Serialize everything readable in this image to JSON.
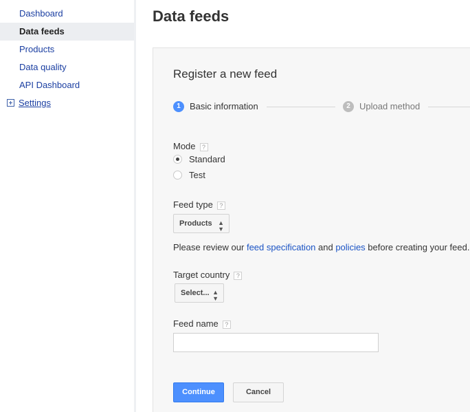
{
  "sidebar": {
    "items": [
      {
        "label": "Dashboard"
      },
      {
        "label": "Data feeds"
      },
      {
        "label": "Products"
      },
      {
        "label": "Data quality"
      },
      {
        "label": "API Dashboard"
      },
      {
        "label": "Settings"
      }
    ],
    "active_item": "Data feeds"
  },
  "page": {
    "title": "Data feeds"
  },
  "form": {
    "title": "Register a new feed",
    "steps": [
      {
        "number": "1",
        "label": "Basic information",
        "state": "active"
      },
      {
        "number": "2",
        "label": "Upload method",
        "state": "inactive"
      }
    ],
    "help_glyph": "?",
    "mode": {
      "label": "Mode",
      "options": [
        {
          "label": "Standard",
          "checked": true
        },
        {
          "label": "Test",
          "checked": false
        }
      ]
    },
    "feed_type": {
      "label": "Feed type",
      "value": "Products"
    },
    "review": {
      "prefix": "Please review our ",
      "link1": "feed specification",
      "middle": " and ",
      "link2": "policies",
      "suffix": " before creating your feed."
    },
    "target_country": {
      "label": "Target country",
      "value": "Select..."
    },
    "feed_name": {
      "label": "Feed name",
      "value": "",
      "placeholder": ""
    },
    "buttons": {
      "continue": "Continue",
      "cancel": "Cancel"
    }
  },
  "colors": {
    "link": "#1a3ea1",
    "primary_button": "#4d90fe",
    "panel_bg": "#f7f7f7",
    "active_nav_bg": "#eceef1"
  },
  "icons": {
    "settings_expand": "plus-box-icon",
    "select_arrows": "up-down-arrows-icon",
    "help": "help-icon"
  }
}
